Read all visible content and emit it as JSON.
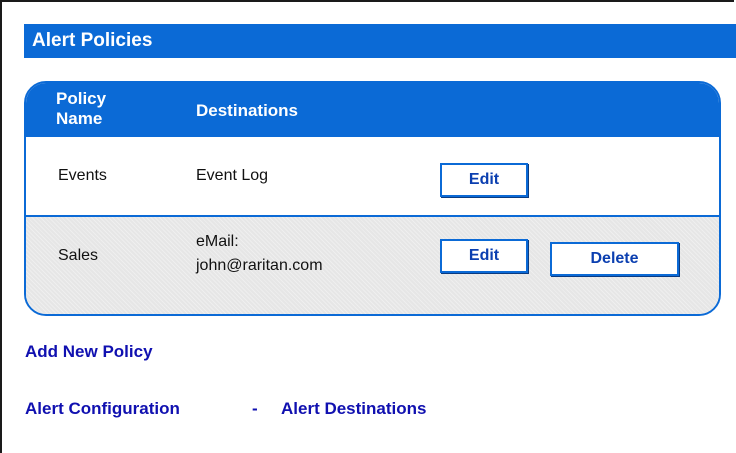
{
  "header": {
    "title": "Alert Policies"
  },
  "table": {
    "columns": {
      "policy_name": "Policy Name",
      "destinations": "Destinations"
    },
    "rows": [
      {
        "name": "Events",
        "destination_line1": "Event Log",
        "destination_line2": "",
        "edit_label": "Edit"
      },
      {
        "name": "Sales",
        "destination_line1": "eMail:",
        "destination_line2": "john@raritan.com",
        "edit_label": "Edit",
        "delete_label": "Delete"
      }
    ]
  },
  "links": {
    "add_new_policy": "Add New Policy",
    "alert_configuration": "Alert Configuration",
    "separator": "-",
    "alert_destinations": "Alert Destinations"
  },
  "colors": {
    "accent": "#0b6ad6",
    "link": "#1010b0",
    "row_alt": "#e6e6e6"
  }
}
